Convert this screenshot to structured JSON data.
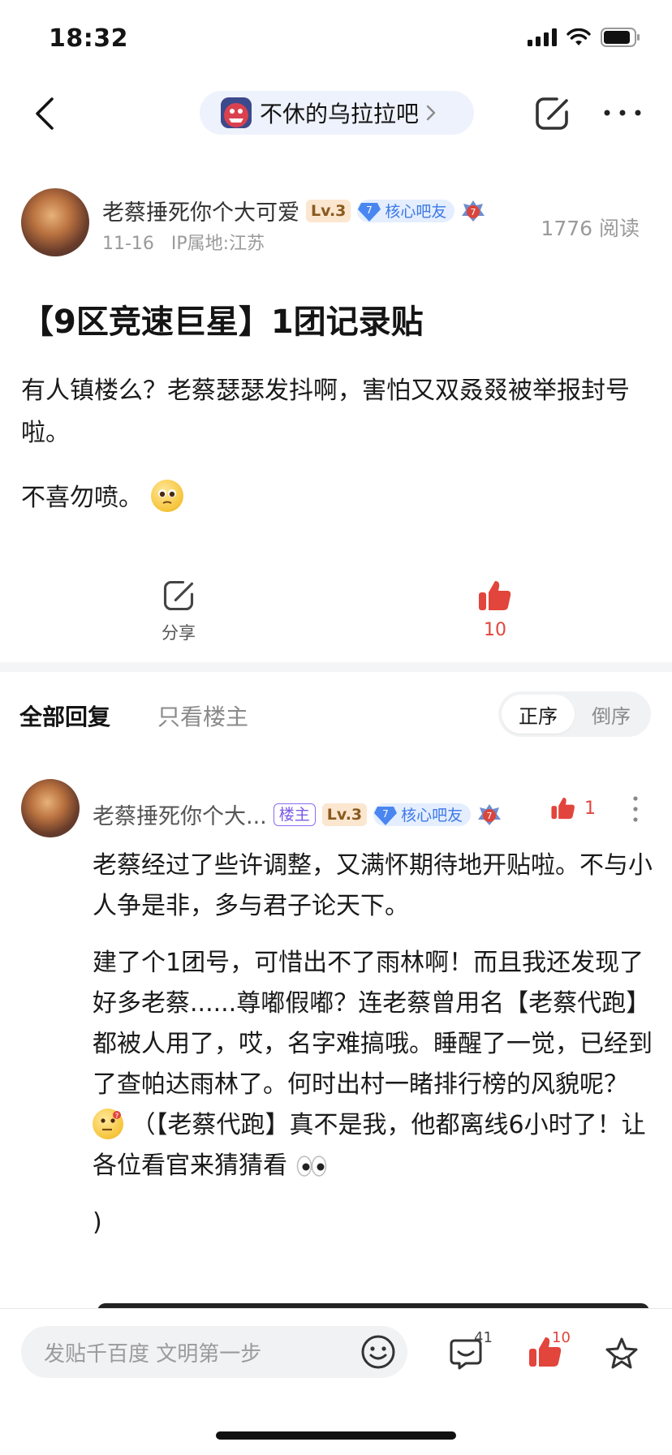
{
  "status_bar": {
    "time": "18:32"
  },
  "nav": {
    "forum_name": "不休的乌拉拉吧"
  },
  "post": {
    "author": "老蔡捶死你个大可爱",
    "level": "Lv.3",
    "core_level": "7",
    "core_label": "核心吧友",
    "medal_number": "7",
    "date": "11-16",
    "ip": "IP属地:江苏",
    "read_count": "1776 阅读",
    "title": "【9区竞速巨星】1团记录贴",
    "paragraph1": "有人镇楼么？老蔡瑟瑟发抖啊，害怕又双叒叕被举报封号啦。",
    "paragraph2": "不喜勿喷。"
  },
  "actions": {
    "share_label": "分享",
    "like_count": "10"
  },
  "tabs": {
    "all": "全部回复",
    "op_only": "只看楼主"
  },
  "sort": {
    "asc": "正序",
    "desc": "倒序",
    "active": "正序"
  },
  "reply": {
    "author": "老蔡捶死你个大...",
    "op_badge": "楼主",
    "level": "Lv.3",
    "core_level": "7",
    "core_label": "核心吧友",
    "medal_number": "7",
    "like_count": "1",
    "para1": "老蔡经过了些许调整，又满怀期待地开贴啦。不与小人争是非，多与君子论天下。",
    "para2_a": "建了个1团号，可惜出不了雨林啊！而且我还发现了好多老蔡......尊嘟假嘟？连老蔡曾用名【老蔡代跑】都被人用了，哎，名字难搞哦。睡醒了一觉，已经到了查帕达雨林了。何时出村一睹排行榜的风貌呢？",
    "para2_b": "（【老蔡代跑】真不是我，他都离线6小时了！让各位看官来猜猜看",
    "para3": ")"
  },
  "bottom_bar": {
    "input_placeholder": "发贴千百度 文明第一步",
    "comment_count": "41",
    "like_count": "10"
  },
  "colors": {
    "accent_red": "#e2453c",
    "core_blue": "#3d78e8",
    "op_purple": "#7a5ae8"
  }
}
